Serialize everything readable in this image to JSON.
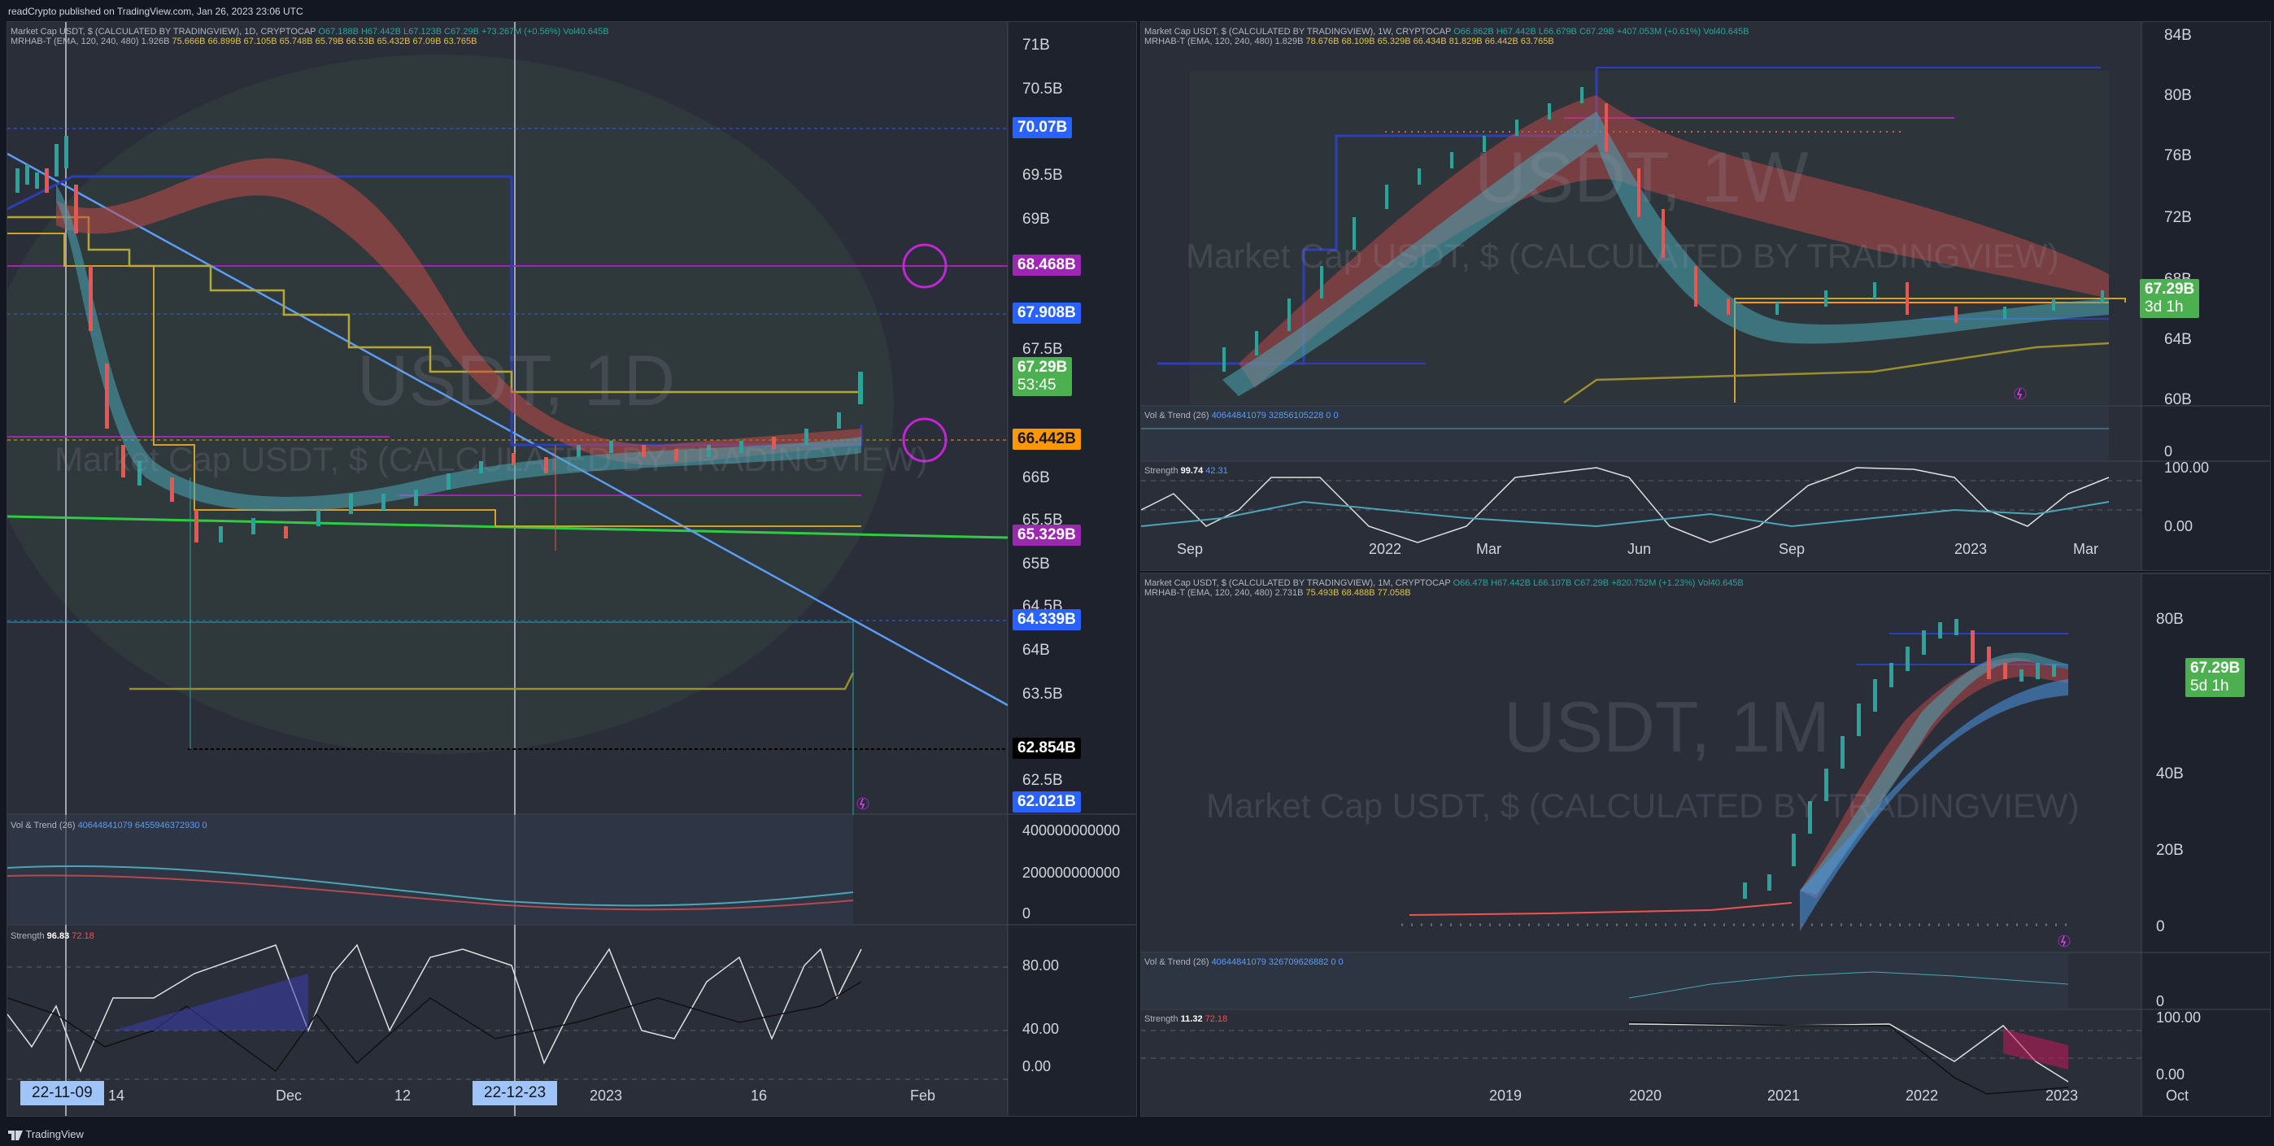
{
  "header": {
    "caption": "readCrypto published on TradingView.com, Jan 26, 2023 23:06 UTC"
  },
  "footer": {
    "brand": "TradingView"
  },
  "colors": {
    "background": "#131722",
    "panel": "#2a2e39",
    "up": "#26a69a",
    "down": "#ef5350",
    "blue_tag": "#2962ff",
    "purple_tag": "#9c27b0",
    "orange_tag": "#ff9800",
    "green_tag": "#4caf50",
    "black_tag": "#000000"
  },
  "icons": [
    "lightning-icon",
    "tradingview-logo-icon"
  ],
  "panel_d": {
    "legend_line1": "Market Cap USDT, $ (CALCULATED BY TRADINGVIEW), 1D, CRYPTOCAP",
    "legend_ohlc": "O67.188B H67.442B L67.123B C67.29B +73.267M (+0.56%) Vol40.645B",
    "legend_line2": "MRHAB-T (EMA, 120, 240, 480) 1.926B",
    "legend_values": "75.666B 66.899B 67.105B 65.748B 65.79B 66.53B 65.432B 67.09B 63.765B",
    "watermark_symbol": "USDT, 1D",
    "watermark_name": "Market Cap USDT, $ (CALCULATED BY TRADINGVIEW)",
    "price_axis": [
      "71B",
      "70.5B",
      "69.5B",
      "69B",
      "67.5B",
      "66B",
      "65.5B",
      "65B",
      "64.5B",
      "64B",
      "63.5B",
      "62.5B"
    ],
    "tags": [
      {
        "label": "70.07B",
        "color": "#2962ff"
      },
      {
        "label": "68.468B",
        "color": "#9c27b0"
      },
      {
        "label": "67.908B",
        "color": "#2962ff"
      },
      {
        "label": "67.29B",
        "sub": "53:45",
        "color": "#4caf50"
      },
      {
        "label": "66.442B",
        "color": "#ff9800"
      },
      {
        "label": "65.329B",
        "color": "#9c27b0"
      },
      {
        "label": "64.339B",
        "color": "#2962ff"
      },
      {
        "label": "62.854B",
        "color": "#000000"
      },
      {
        "label": "62.021B",
        "color": "#2962ff"
      }
    ],
    "vol_label": "Vol & Trend (26)",
    "vol_values": "40644841079 6455946372930 0",
    "vol_axis": [
      "400000000000",
      "200000000000",
      "0"
    ],
    "strength_label": "Strength",
    "strength_value": "96.83",
    "strength_value2": "72.18",
    "strength_axis": [
      "80.00",
      "40.00",
      "0.00"
    ],
    "time_axis": [
      "14",
      "Dec",
      "12",
      "2023",
      "16",
      "Feb"
    ],
    "cursor_dates": [
      "22-11-09",
      "22-12-23"
    ]
  },
  "panel_w": {
    "legend_line1": "Market Cap USDT, $ (CALCULATED BY TRADINGVIEW), 1W, CRYPTOCAP",
    "legend_ohlc": "O66.862B H67.442B L66.679B C67.29B +407.053M (+0.61%) Vol40.645B",
    "legend_line2": "MRHAB-T (EMA, 120, 240, 480) 1.829B",
    "legend_values": "78.676B 68.109B 65.329B 66.434B 81.829B 66.442B 63.765B",
    "watermark_symbol": "USDT, 1W",
    "watermark_name": "Market Cap USDT, $ (CALCULATED BY TRADINGVIEW)",
    "price_axis": [
      "84B",
      "80B",
      "76B",
      "72B",
      "68B",
      "64B",
      "60B"
    ],
    "tag_label": "67.29B",
    "tag_sub": "3d 1h",
    "vol_label": "Vol & Trend (26)",
    "vol_values": "40644841079 32856105228 0 0",
    "vol_axis": [
      "0"
    ],
    "strength_label": "Strength",
    "strength_value": "99.74",
    "strength_value2": "42.31",
    "strength_axis": [
      "100.00",
      "0.00"
    ],
    "time_axis": [
      "Sep",
      "2022",
      "Mar",
      "Jun",
      "Sep",
      "2023",
      "Mar"
    ]
  },
  "panel_m": {
    "legend_line1": "Market Cap USDT, $ (CALCULATED BY TRADINGVIEW), 1M, CRYPTOCAP",
    "legend_ohlc": "O66.47B H67.442B L66.107B C67.29B +820.752M (+1.23%) Vol40.645B",
    "legend_line2": "MRHAB-T (EMA, 120, 240, 480) 2.731B",
    "legend_values": "75.493B 68.488B 77.058B",
    "watermark_symbol": "USDT, 1M",
    "watermark_name": "Market Cap USDT, $ (CALCULATED BY TRADINGVIEW)",
    "price_axis": [
      "80B",
      "40B",
      "20B",
      "0"
    ],
    "tag_label": "67.29B",
    "tag_sub": "5d 1h",
    "vol_label": "Vol & Trend (26)",
    "vol_values": "40644841079 326709626882 0 0",
    "vol_axis": [
      "0"
    ],
    "strength_label": "Strength",
    "strength_value": "11.32",
    "strength_value2": "72.18",
    "strength_axis": [
      "100.00",
      "0.00"
    ],
    "time_axis": [
      "2019",
      "2020",
      "2021",
      "2022",
      "2023",
      "Oct"
    ]
  }
}
